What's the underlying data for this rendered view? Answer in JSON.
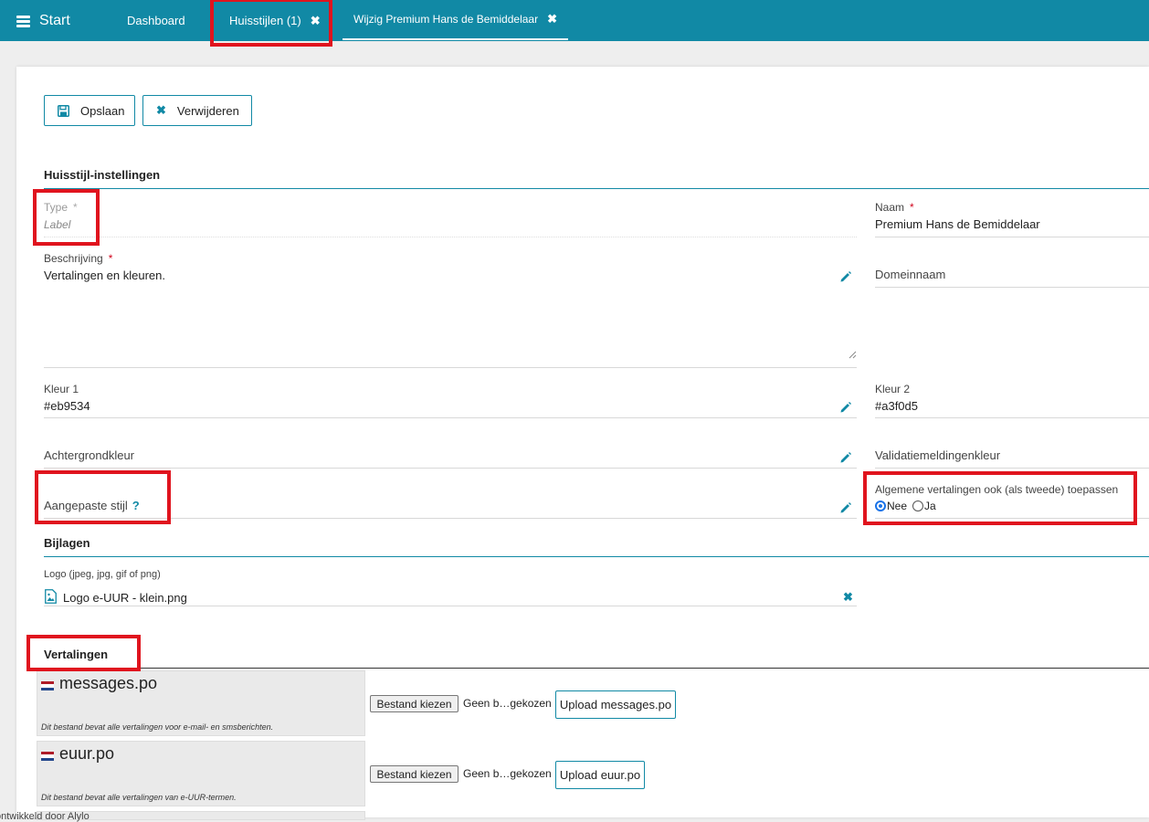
{
  "topbar": {
    "menu_label": "Start",
    "tabs": [
      {
        "label": "Dashboard"
      },
      {
        "label": "Huisstijlen (1)",
        "close": "✖"
      },
      {
        "label": "Wijzig Premium Hans de Bemiddelaar",
        "close": "✖"
      }
    ]
  },
  "toolbar": {
    "save_label": "Opslaan",
    "delete_label": "Verwijderen"
  },
  "form": {
    "section_title": "Huisstijl-instellingen",
    "type": {
      "label": "Type",
      "value": "Label"
    },
    "naam": {
      "label": "Naam",
      "value": "Premium Hans de Bemiddelaar"
    },
    "beschrijving": {
      "label": "Beschrijving",
      "value": "Vertalingen en kleuren."
    },
    "domeinnaam": {
      "label": "Domeinnaam",
      "value": ""
    },
    "kleur1": {
      "label": "Kleur 1",
      "value": "#eb9534"
    },
    "kleur2": {
      "label": "Kleur 2",
      "value": "#a3f0d5"
    },
    "achtergrondkleur": {
      "label": "Achtergrondkleur",
      "value": ""
    },
    "validatiemeldingenkleur": {
      "label": "Validatiemeldingenkleur",
      "value": ""
    },
    "aangepaste_stijl": {
      "label": "Aangepaste stijl",
      "help": "?"
    },
    "algemene_vertalingen": {
      "label": "Algemene vertalingen ook (als tweede) toepassen",
      "options": [
        "Nee",
        "Ja"
      ],
      "selected": "Nee"
    },
    "required_marker": "*"
  },
  "bijlagen": {
    "section_title": "Bijlagen",
    "logo_label": "Logo (jpeg, jpg, gif of png)",
    "logo_file": "Logo e-UUR - klein.png"
  },
  "vertalingen": {
    "section_title": "Vertalingen",
    "items": [
      {
        "name": "messages.po",
        "description": "Dit bestand bevat alle vertalingen voor e-mail- en smsberichten.",
        "choose_label": "Bestand kiezen",
        "no_file": "Geen b…gekozen",
        "upload_label": "Upload messages.po"
      },
      {
        "name": "euur.po",
        "description": "Dit bestand bevat alle vertalingen van e-UUR-termen.",
        "choose_label": "Bestand kiezen",
        "no_file": "Geen b…gekozen",
        "upload_label": "Upload euur.po"
      }
    ]
  },
  "footer": {
    "text": "ontwikkeld door Alylo"
  },
  "colors": {
    "accent": "#1189a5",
    "required": "#d0021b",
    "highlight": "#e0141e"
  },
  "icons": {
    "menu": "hamburger-icon",
    "close": "close-icon",
    "save": "floppy-disk-icon",
    "delete": "x-icon",
    "edit": "pencil-icon",
    "image_file": "image-file-icon",
    "remove": "x-icon",
    "flag": "dutch-flag-icon"
  }
}
